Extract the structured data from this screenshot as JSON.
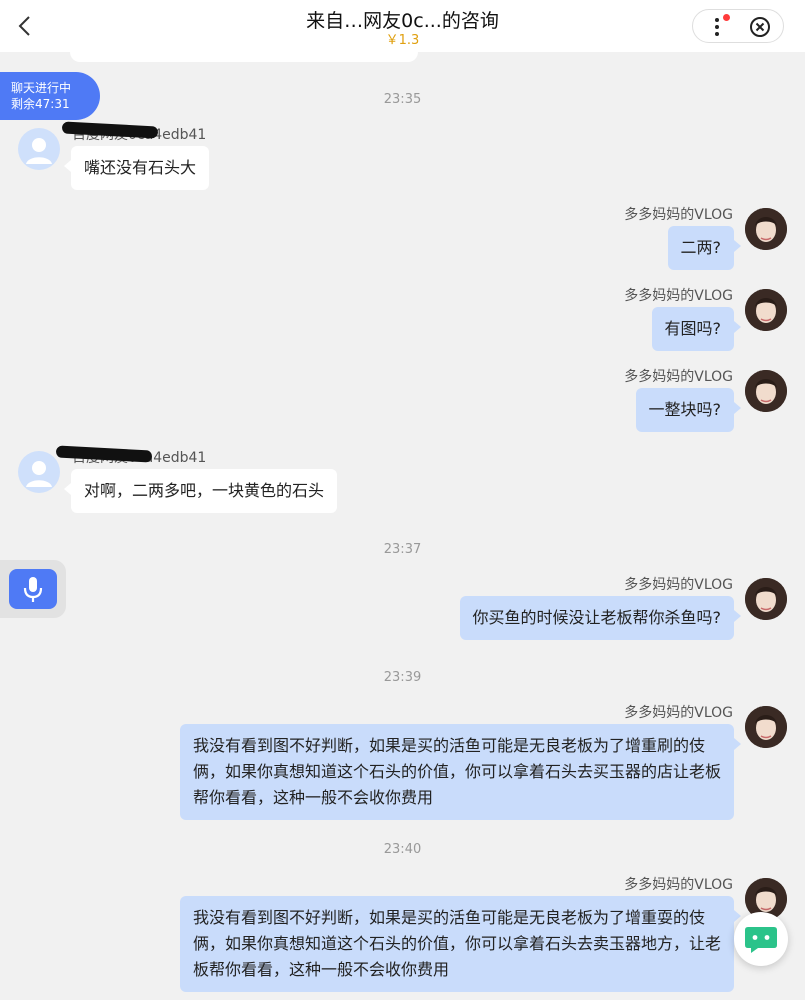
{
  "header": {
    "title": "来自…网友0c...的咨询",
    "price": "￥1.3"
  },
  "status": {
    "line1": "聊天进行中",
    "line2": "剩余47:31"
  },
  "names": {
    "asker_suffix": "a4edb41",
    "expert": "多多妈妈的VLOG"
  },
  "times": [
    "23:35",
    "23:37",
    "23:39",
    "23:40"
  ],
  "messages": {
    "m1": "嘴还没有石头大",
    "m2": "二两?",
    "m3": "有图吗?",
    "m4": "一整块吗?",
    "m5": "对啊，二两多吧，一块黄色的石头",
    "m6": "你买鱼的时候没让老板帮你杀鱼吗?",
    "m7": "我没有看到图不好判断，如果是买的活鱼可能是无良老板为了增重刷的伎俩，如果你真想知道这个石头的价值，你可以拿着石头去买玉器的店让老板帮你看看，这种一般不会收你费用",
    "m8": "我没有看到图不好判断，如果是买的活鱼可能是无良老板为了增重耍的伎俩，如果你真想知道这个石头的价值，你可以拿着石头去卖玉器地方，让老板帮你看看，这种一般不会收你费用"
  },
  "colors": {
    "accent": "#4f7af5",
    "bubble_right": "#c9dcfb",
    "price": "#e0a010"
  }
}
